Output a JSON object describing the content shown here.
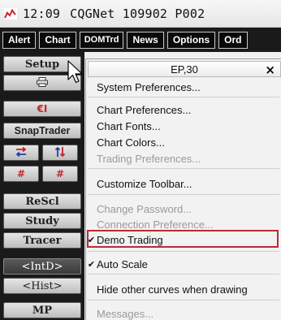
{
  "titlebar": {
    "time": "12:09",
    "title": "CQGNet 109902   P002"
  },
  "toolbar": {
    "buttons": [
      "Alert",
      "Chart",
      "DOMTrd",
      "News",
      "Options",
      "Ord"
    ]
  },
  "sidebar": {
    "setup": "Setup",
    "print_icon": "printer-icon",
    "el_label": "€I",
    "snaptrader": "SnapTrader",
    "rescl": "ReScl",
    "study": "Study",
    "tracer": "Tracer",
    "intd": "<IntD>",
    "hist": "<Hist>",
    "mp": "MP"
  },
  "menu": {
    "header": "EP,30",
    "close": "×",
    "items": [
      {
        "label": "System Preferences...",
        "disabled": false
      },
      {
        "label": "Chart Preferences...",
        "disabled": false
      },
      {
        "label": "Chart Fonts...",
        "disabled": false
      },
      {
        "label": "Chart Colors...",
        "disabled": false
      },
      {
        "label": "Trading Preferences...",
        "disabled": true
      },
      {
        "label": "Customize Toolbar...",
        "disabled": false
      },
      {
        "label": "Change Password...",
        "disabled": true
      },
      {
        "label": "Connection Preference...",
        "disabled": true
      },
      {
        "label": "Demo Trading",
        "disabled": false,
        "checked": true
      },
      {
        "label": "Auto Scale",
        "disabled": false,
        "checked": true
      },
      {
        "label": "Hide other curves when drawing",
        "disabled": false
      },
      {
        "label": "Messages...",
        "disabled": true
      }
    ],
    "highlight_color": "#b82c34"
  }
}
